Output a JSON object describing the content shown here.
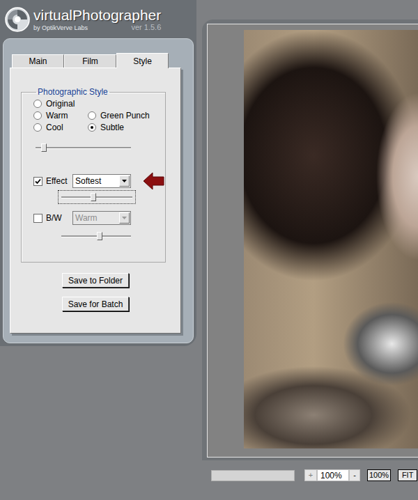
{
  "app": {
    "title": "virtualPhotographer",
    "subtitle": "by OptikVerve Labs",
    "version": "ver 1.5.6"
  },
  "tabs": [
    {
      "label": "Main",
      "selected": false
    },
    {
      "label": "Film",
      "selected": false
    },
    {
      "label": "Style",
      "selected": true
    }
  ],
  "style_group": {
    "title": "Photographic Style",
    "options": [
      {
        "label": "Original",
        "selected": false
      },
      {
        "label": "Warm",
        "selected": false
      },
      {
        "label": "Green Punch",
        "selected": false
      },
      {
        "label": "Cool",
        "selected": false
      },
      {
        "label": "Subtle",
        "selected": true
      }
    ],
    "level": 0.06
  },
  "effect": {
    "label": "Effect",
    "checked": true,
    "value": "Softest",
    "disabled": false,
    "level": 0.45,
    "focused": true
  },
  "bw": {
    "label": "B/W",
    "checked": false,
    "value": "Warm",
    "disabled": true,
    "level": 0.55,
    "focused": false
  },
  "buttons": [
    "Save to Folder",
    "Save for Batch"
  ],
  "zoom": {
    "progress": 0,
    "zoom_in": "+",
    "value": "100%",
    "zoom_out": "-",
    "actual": "100%",
    "fit": "FIT"
  }
}
